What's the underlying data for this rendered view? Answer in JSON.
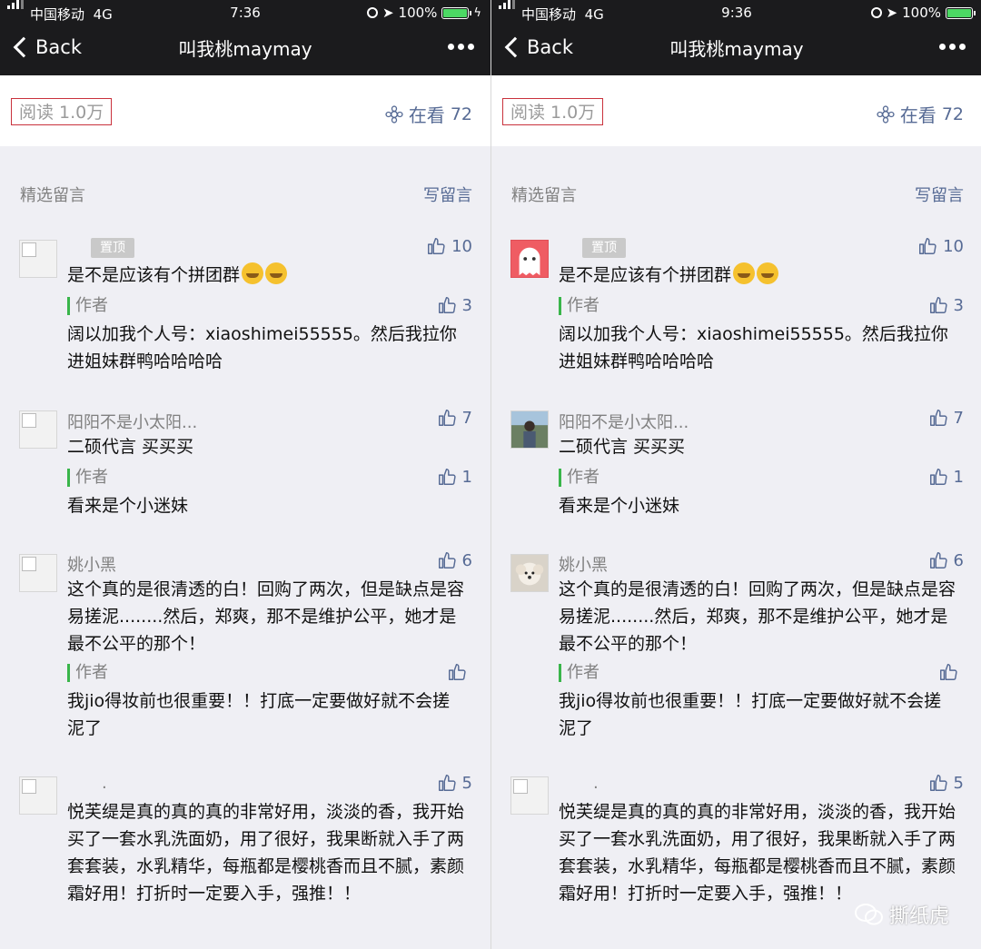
{
  "panels": [
    {
      "status": {
        "carrier": "中国移动",
        "network": "4G",
        "time": "7:36",
        "battery": "100%"
      },
      "nav": {
        "back": "Back",
        "title": "叫我桃maymay"
      },
      "read_label": "阅读 1.0万",
      "zaikan_label": "在看",
      "zaikan_count": "72",
      "section_title": "精选留言",
      "write_label": "写留言",
      "comments": [
        {
          "pin": "置顶",
          "text": "是不是应该有个拼团群",
          "likes": "10",
          "reply_author": "作者",
          "reply_text": "阔以加我个人号：xiaoshimei55555。然后我拉你进姐妹群鸭哈哈哈哈",
          "reply_likes": "3"
        },
        {
          "name": "阳阳不是小太阳...",
          "text": "二硕代言 买买买",
          "likes": "7",
          "reply_author": "作者",
          "reply_text": "看来是个小迷妹",
          "reply_likes": "1"
        },
        {
          "name": "姚小黑",
          "text": "这个真的是很清透的白！回购了两次，但是缺点是容易搓泥........然后，郑爽，那不是维护公平，她才是最不公平的那个！",
          "likes": "6",
          "reply_author": "作者",
          "reply_text": "我jio得妆前也很重要！！打底一定要做好就不会搓泥了",
          "reply_likes": ""
        },
        {
          "name": ".",
          "text": "悦芙缇是真的真的真的非常好用，淡淡的香，我开始买了一套水乳洗面奶，用了很好，我果断就入手了两套套装，水乳精华，每瓶都是樱桃香而且不腻，素颜霜好用！打折时一定要入手，强推！！",
          "likes": "5"
        }
      ]
    },
    {
      "status": {
        "carrier": "中国移动",
        "network": "4G",
        "time": "9:36",
        "battery": "100%"
      },
      "nav": {
        "back": "Back",
        "title": "叫我桃maymay"
      },
      "read_label": "阅读 1.0万",
      "zaikan_label": "在看",
      "zaikan_count": "72",
      "section_title": "精选留言",
      "write_label": "写留言",
      "comments": [
        {
          "pin": "置顶",
          "text": "是不是应该有个拼团群",
          "likes": "10",
          "reply_author": "作者",
          "reply_text": "阔以加我个人号：xiaoshimei55555。然后我拉你进姐妹群鸭哈哈哈哈",
          "reply_likes": "3"
        },
        {
          "name": "阳阳不是小太阳...",
          "text": "二硕代言 买买买",
          "likes": "7",
          "reply_author": "作者",
          "reply_text": "看来是个小迷妹",
          "reply_likes": "1"
        },
        {
          "name": "姚小黑",
          "text": "这个真的是很清透的白！回购了两次，但是缺点是容易搓泥........然后，郑爽，那不是维护公平，她才是最不公平的那个！",
          "likes": "6",
          "reply_author": "作者",
          "reply_text": "我jio得妆前也很重要！！打底一定要做好就不会搓泥了",
          "reply_likes": ""
        },
        {
          "name": ".",
          "text": "悦芙缇是真的真的真的非常好用，淡淡的香，我开始买了一套水乳洗面奶，用了很好，我果断就入手了两套套装，水乳精华，每瓶都是樱桃香而且不腻，素颜霜好用！打折时一定要入手，强推！！",
          "likes": "5"
        }
      ]
    }
  ],
  "watermark": "撕纸虎",
  "colors": {
    "link": "#576b95",
    "author_bar": "#39b54a",
    "highlight_box": "#c9323c",
    "battery": "#4cd964"
  }
}
